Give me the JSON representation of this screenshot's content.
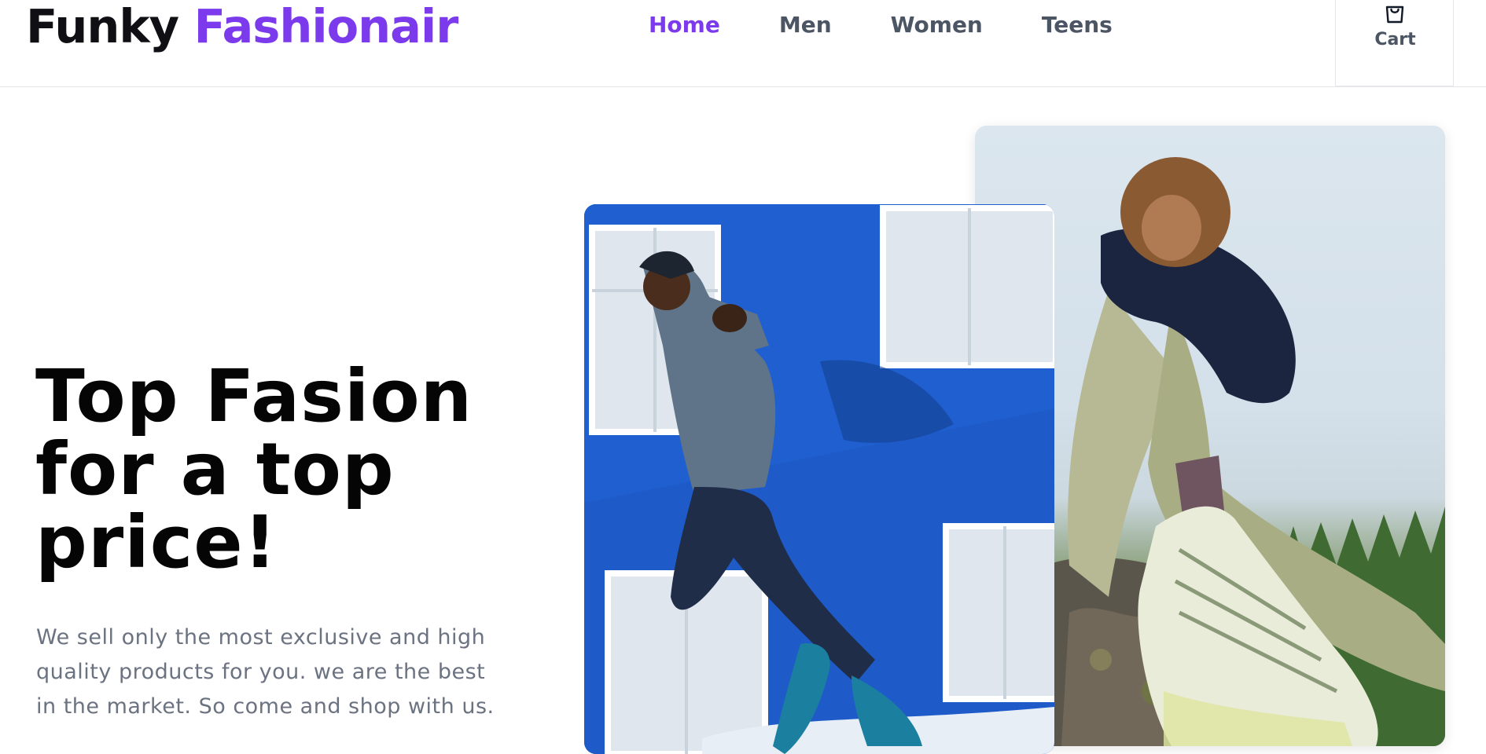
{
  "brand": {
    "name_part1": "Funky",
    "name_part2": "Fashionair",
    "accent_color": "#7c3aed"
  },
  "nav": {
    "items": [
      {
        "label": "Home",
        "active": true
      },
      {
        "label": "Men",
        "active": false
      },
      {
        "label": "Women",
        "active": false
      },
      {
        "label": "Teens",
        "active": false
      }
    ]
  },
  "cart": {
    "label": "Cart",
    "icon": "shopping-bag-icon"
  },
  "hero": {
    "title": "Top Fasion for a top price!",
    "description": "We sell only the most exclusive and high quality products for you. we are the best in the market. So come and shop with us."
  },
  "images": [
    {
      "subject": "man in hooded jacket jumping in front of blue building",
      "icon": "photo-runner"
    },
    {
      "subject": "woman sitting on rock wearing sneakers",
      "icon": "photo-sneakers"
    }
  ]
}
